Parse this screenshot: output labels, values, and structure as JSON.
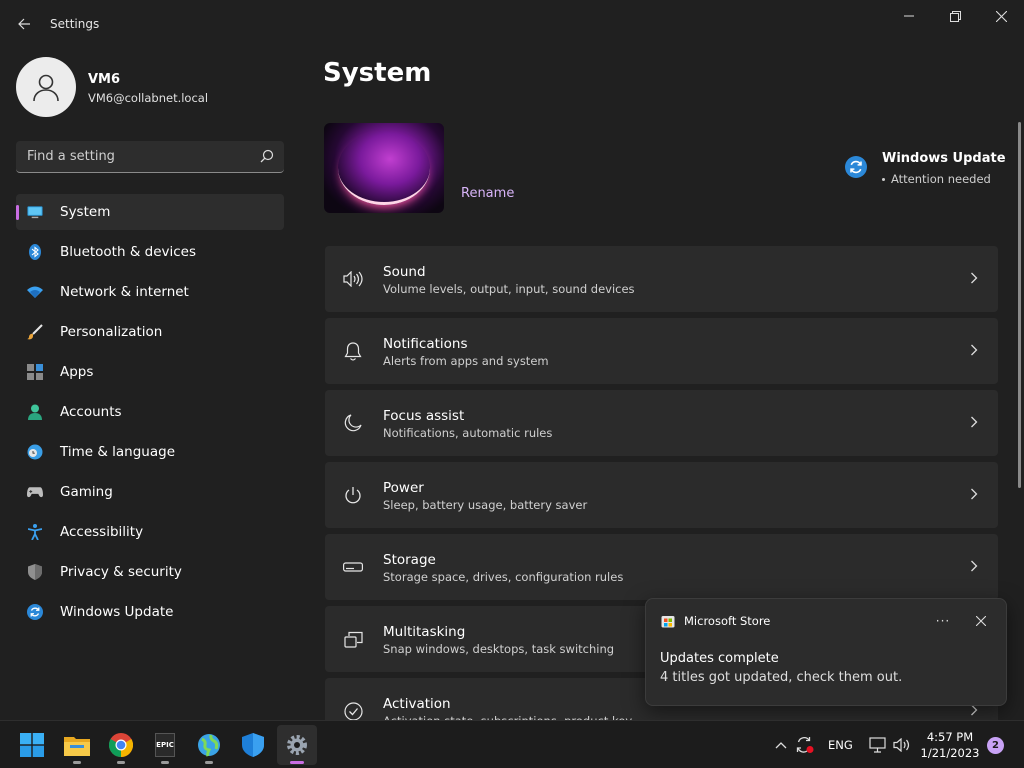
{
  "window": {
    "title": "Settings"
  },
  "profile": {
    "name": "VM6",
    "email": "VM6@collabnet.local"
  },
  "search": {
    "placeholder": "Find a setting"
  },
  "sidebar": {
    "items": [
      {
        "label": "System",
        "icon": "monitor-icon",
        "active": true
      },
      {
        "label": "Bluetooth & devices",
        "icon": "bluetooth-icon"
      },
      {
        "label": "Network & internet",
        "icon": "wifi-icon"
      },
      {
        "label": "Personalization",
        "icon": "brush-icon"
      },
      {
        "label": "Apps",
        "icon": "apps-icon"
      },
      {
        "label": "Accounts",
        "icon": "person-icon"
      },
      {
        "label": "Time & language",
        "icon": "clock-globe-icon"
      },
      {
        "label": "Gaming",
        "icon": "gamepad-icon"
      },
      {
        "label": "Accessibility",
        "icon": "accessibility-icon"
      },
      {
        "label": "Privacy & security",
        "icon": "shield-icon"
      },
      {
        "label": "Windows Update",
        "icon": "update-icon"
      }
    ]
  },
  "main": {
    "title": "System",
    "rename_label": "Rename",
    "windows_update": {
      "title": "Windows Update",
      "status": "Attention needed"
    },
    "cards": [
      {
        "title": "Sound",
        "subtitle": "Volume levels, output, input, sound devices",
        "icon": "speaker-icon"
      },
      {
        "title": "Notifications",
        "subtitle": "Alerts from apps and system",
        "icon": "bell-icon"
      },
      {
        "title": "Focus assist",
        "subtitle": "Notifications, automatic rules",
        "icon": "moon-icon"
      },
      {
        "title": "Power",
        "subtitle": "Sleep, battery usage, battery saver",
        "icon": "power-icon"
      },
      {
        "title": "Storage",
        "subtitle": "Storage space, drives, configuration rules",
        "icon": "drive-icon"
      },
      {
        "title": "Multitasking",
        "subtitle": "Snap windows, desktops, task switching",
        "icon": "multitask-icon"
      },
      {
        "title": "Activation",
        "subtitle": "Activation state, subscriptions, product key",
        "icon": "check-circle-icon"
      }
    ]
  },
  "toast": {
    "app": "Microsoft Store",
    "title": "Updates complete",
    "body": "4 titles got updated, check them out.",
    "more_glyph": "···"
  },
  "taskbar": {
    "apps": [
      "start-icon",
      "file-explorer-icon",
      "chrome-icon",
      "epic-games-icon",
      "globe-app-icon",
      "defender-icon",
      "settings-icon"
    ],
    "epic_text": "EPIC",
    "language": "ENG",
    "time": "4:57 PM",
    "date": "1/21/2023",
    "notification_count": "2"
  },
  "colors": {
    "accent": "#c96de3",
    "link": "#d8b4f8",
    "background": "#202020",
    "card": "#2b2b2b"
  }
}
